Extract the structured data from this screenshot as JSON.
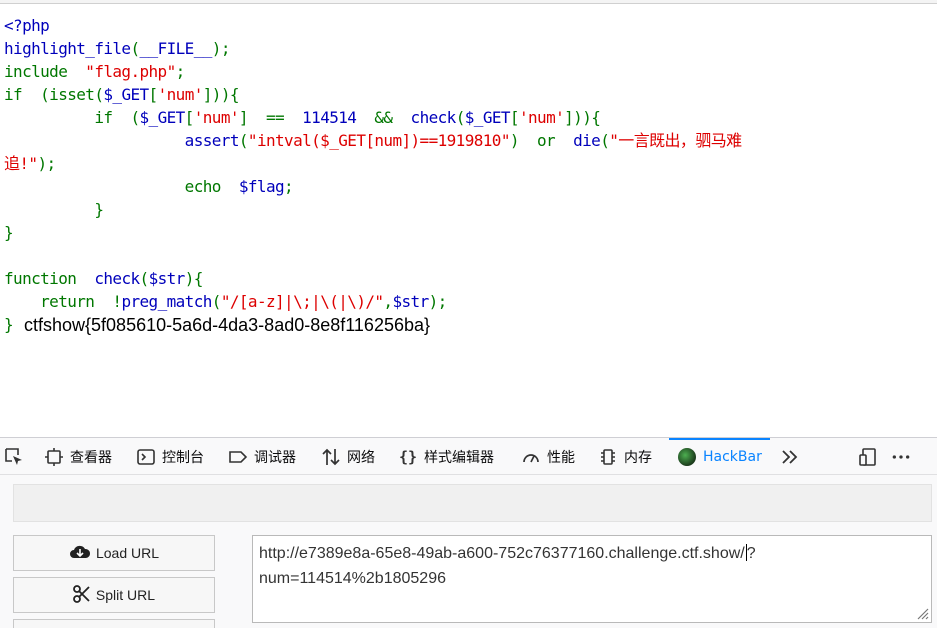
{
  "code": {
    "lines": [
      [
        [
          "def",
          "<?php"
        ]
      ],
      [
        [
          "def",
          "highlight_file"
        ],
        [
          "kw",
          "("
        ],
        [
          "def",
          "__FILE__"
        ],
        [
          "kw",
          ");"
        ]
      ],
      [
        [
          "kw",
          "include  "
        ],
        [
          "str",
          "\"flag.php\""
        ],
        [
          "kw",
          ";"
        ]
      ],
      [
        [
          "kw",
          "if  (isset("
        ],
        [
          "def",
          "$_GET"
        ],
        [
          "kw",
          "["
        ],
        [
          "str",
          "'num'"
        ],
        [
          "kw",
          "])){"
        ]
      ],
      [
        [
          "kw",
          "          if  ("
        ],
        [
          "def",
          "$_GET"
        ],
        [
          "kw",
          "["
        ],
        [
          "str",
          "'num'"
        ],
        [
          "kw",
          "]  ==  "
        ],
        [
          "def",
          "114514"
        ],
        [
          "kw",
          "  &&  "
        ],
        [
          "def",
          "check"
        ],
        [
          "kw",
          "("
        ],
        [
          "def",
          "$_GET"
        ],
        [
          "kw",
          "["
        ],
        [
          "str",
          "'num'"
        ],
        [
          "kw",
          "])){"
        ]
      ],
      [
        [
          "kw",
          "                    "
        ],
        [
          "def",
          "assert"
        ],
        [
          "kw",
          "("
        ],
        [
          "str",
          "\"intval($_GET[num])==1919810\""
        ],
        [
          "kw",
          ")  or  "
        ],
        [
          "def",
          "die"
        ],
        [
          "kw",
          "("
        ],
        [
          "str",
          "\"一言既出，驷马难"
        ]
      ],
      [
        [
          "str",
          "追!\""
        ],
        [
          "kw",
          ");"
        ]
      ],
      [
        [
          "kw",
          "                    echo  "
        ],
        [
          "def",
          "$flag"
        ],
        [
          "kw",
          ";"
        ]
      ],
      [
        [
          "kw",
          "          }"
        ]
      ],
      [
        [
          "kw",
          "}"
        ]
      ],
      [
        [
          "kw",
          ""
        ]
      ],
      [
        [
          "kw",
          "function  "
        ],
        [
          "def",
          "check"
        ],
        [
          "kw",
          "("
        ],
        [
          "def",
          "$str"
        ],
        [
          "kw",
          "){"
        ]
      ],
      [
        [
          "kw",
          "    return  !"
        ],
        [
          "def",
          "preg_match"
        ],
        [
          "kw",
          "("
        ],
        [
          "str",
          "\"/[a-z]|\\;|\\(|\\)/\""
        ],
        [
          "kw",
          ","
        ],
        [
          "def",
          "$str"
        ],
        [
          "kw",
          ");"
        ]
      ],
      [
        [
          "kw",
          "}"
        ]
      ]
    ],
    "output": "ctfshow{5f085610-5a6d-4da3-8ad0-8e8f116256ba}"
  },
  "devtools": {
    "tabs": [
      {
        "label": "",
        "icon": "pick-element-icon"
      },
      {
        "label": "查看器",
        "icon": "inspector-icon"
      },
      {
        "label": "控制台",
        "icon": "console-icon"
      },
      {
        "label": "调试器",
        "icon": "debugger-icon"
      },
      {
        "label": "网络",
        "icon": "network-icon"
      },
      {
        "label": "样式编辑器",
        "icon": "style-editor-icon"
      },
      {
        "label": "性能",
        "icon": "performance-icon"
      },
      {
        "label": "内存",
        "icon": "memory-icon"
      },
      {
        "label": "HackBar",
        "icon": "hackbar-icon",
        "active": true
      }
    ],
    "active_color": "#0a84ff"
  },
  "hackbar": {
    "load_url": "Load URL",
    "split_url": "Split URL",
    "url_line1": "http://e7389e8a-65e8-49ab-a600-752c76377160.challenge.ctf.show/",
    "url_line1_after_caret": "?",
    "url_line2": "num=114514%2b1805296"
  }
}
